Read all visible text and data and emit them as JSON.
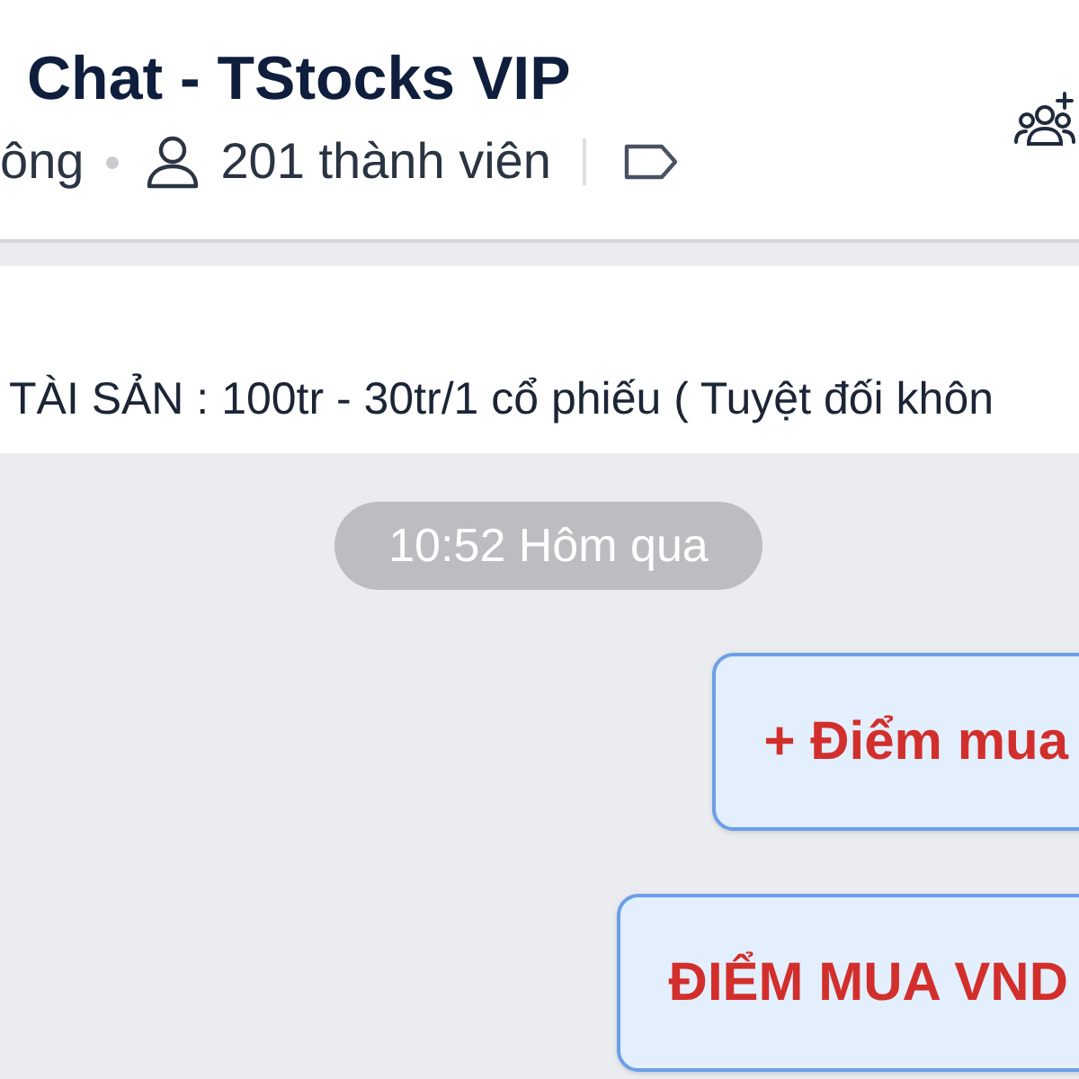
{
  "header": {
    "title": "Chat - TStocks VIP",
    "status": "ông",
    "member_count": "201 thành viên"
  },
  "pinned_message": {
    "text": "TÀI SẢN : 100tr - 30tr/1 cổ phiếu ( Tuyệt đối khôn"
  },
  "messages": [
    {
      "kind": "timestamp",
      "text": "10:52 Hôm qua"
    },
    {
      "kind": "bubble",
      "text": "+ Điểm mua"
    },
    {
      "kind": "bubble",
      "text": "ĐIỂM MUA VND"
    }
  ]
}
